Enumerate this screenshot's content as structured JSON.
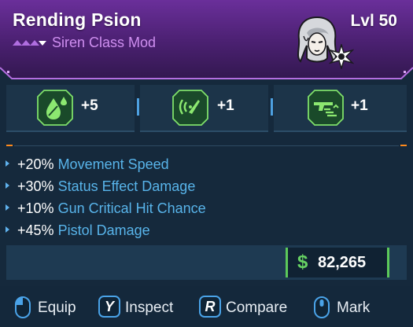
{
  "header": {
    "title": "Rending Psion",
    "level": "Lvl 50",
    "subtitle": "Siren Class Mod",
    "rarity_icon": "epic-rarity-chevrons-icon",
    "portrait_icon": "siren-portrait-icon",
    "class_badge_icon": "class-badge-icon",
    "accent_color": "#6a2f9a",
    "subtitle_color": "#cf8ff0"
  },
  "perks": [
    {
      "icon": "drops-skill-icon",
      "value": "+5"
    },
    {
      "icon": "soundwave-skill-icon",
      "value": "+1"
    },
    {
      "icon": "gun-skill-icon",
      "value": "+1"
    }
  ],
  "stats": [
    {
      "value": "+20%",
      "name": "Movement Speed"
    },
    {
      "value": "+30%",
      "name": "Status Effect Damage"
    },
    {
      "value": "+10%",
      "name": "Gun Critical Hit Chance"
    },
    {
      "value": "+45%",
      "name": "Pistol Damage"
    }
  ],
  "price": {
    "currency_symbol": "$",
    "value": "82,265",
    "color": "#5cc95a"
  },
  "actions": [
    {
      "key": "left-mouse-button-icon",
      "label": "Equip"
    },
    {
      "key": "Y",
      "label": "Inspect"
    },
    {
      "key": "R",
      "label": "Compare"
    },
    {
      "key": "middle-mouse-button-icon",
      "label": "Mark"
    }
  ]
}
